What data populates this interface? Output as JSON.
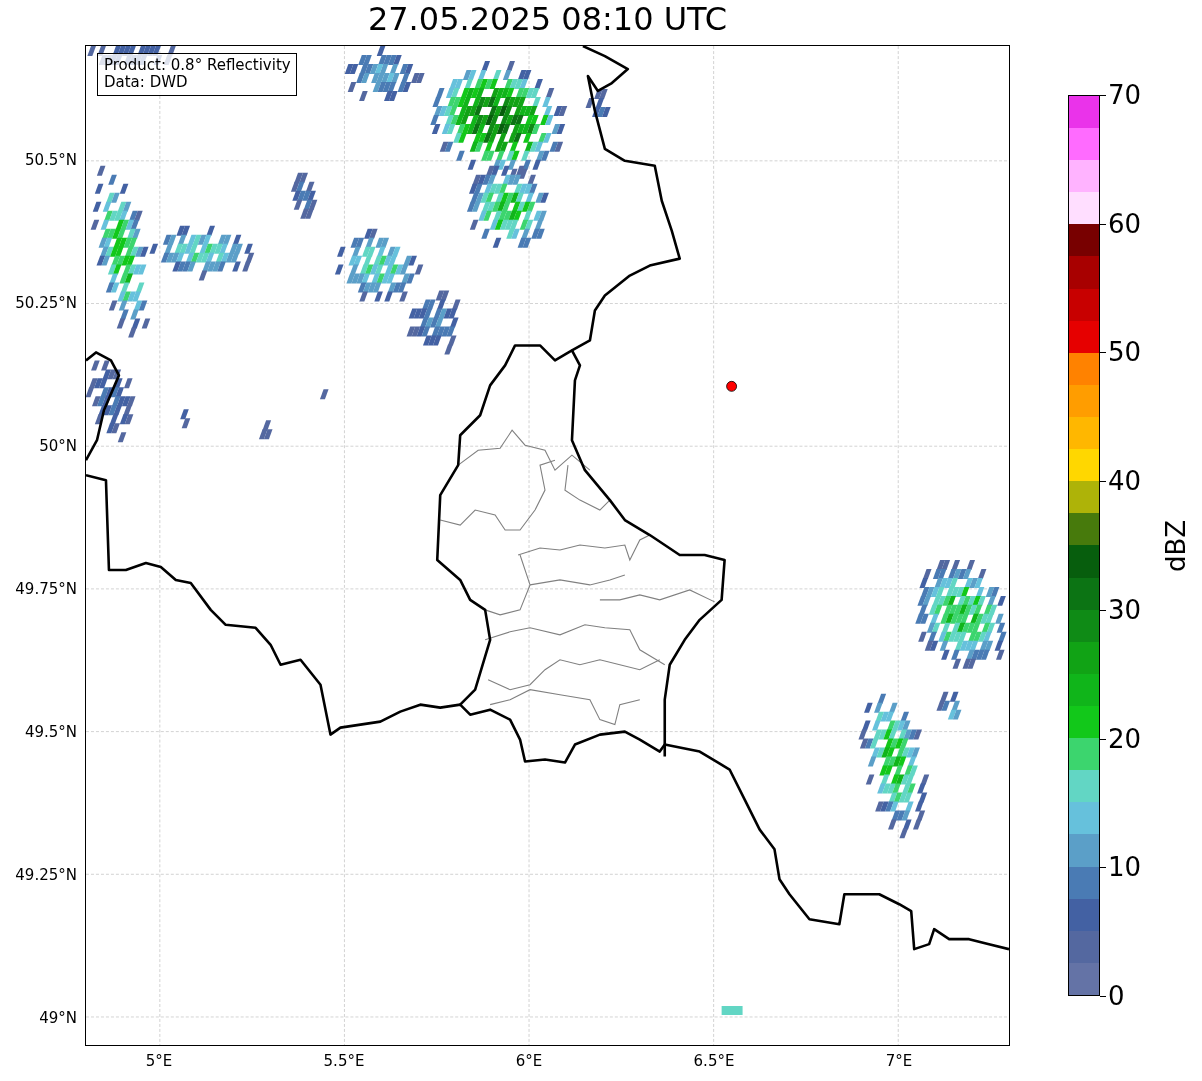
{
  "title": "27.05.2025 08:10 UTC",
  "map": {
    "info_lines": [
      "Product: 0.8° Reflectivity",
      "Data: DWD"
    ],
    "lat_ticks": [
      "50.5°N",
      "50.25°N",
      "50°N",
      "49.75°N",
      "49.5°N",
      "49.25°N",
      "49°N"
    ],
    "lon_ticks": [
      "5°E",
      "5.5°E",
      "6°E",
      "6.5°E",
      "7°E"
    ]
  },
  "colorbar": {
    "label": "dBZ",
    "ticks": [
      "70",
      "60",
      "50",
      "40",
      "30",
      "20",
      "10",
      "0"
    ],
    "bins": [
      {
        "color": "#6473a6"
      },
      {
        "color": "#5468a0"
      },
      {
        "color": "#4361a3"
      },
      {
        "color": "#4a7bb4"
      },
      {
        "color": "#5b9fc8"
      },
      {
        "color": "#66c1dc"
      },
      {
        "color": "#62d6c4"
      },
      {
        "color": "#3cd56e"
      },
      {
        "color": "#12c81a"
      },
      {
        "color": "#10b51a"
      },
      {
        "color": "#11a315"
      },
      {
        "color": "#0f8b16"
      },
      {
        "color": "#0c7414"
      },
      {
        "color": "#075e0d"
      },
      {
        "color": "#477a0c"
      },
      {
        "color": "#aeb308"
      },
      {
        "color": "#ffd700"
      },
      {
        "color": "#ffb700"
      },
      {
        "color": "#ff9d00"
      },
      {
        "color": "#ff8200"
      },
      {
        "color": "#e60000"
      },
      {
        "color": "#c80000"
      },
      {
        "color": "#a80000"
      },
      {
        "color": "#780000"
      },
      {
        "color": "#ffdeff"
      },
      {
        "color": "#ffb3ff"
      },
      {
        "color": "#ff6bff"
      },
      {
        "color": "#ea33ea"
      }
    ]
  }
}
